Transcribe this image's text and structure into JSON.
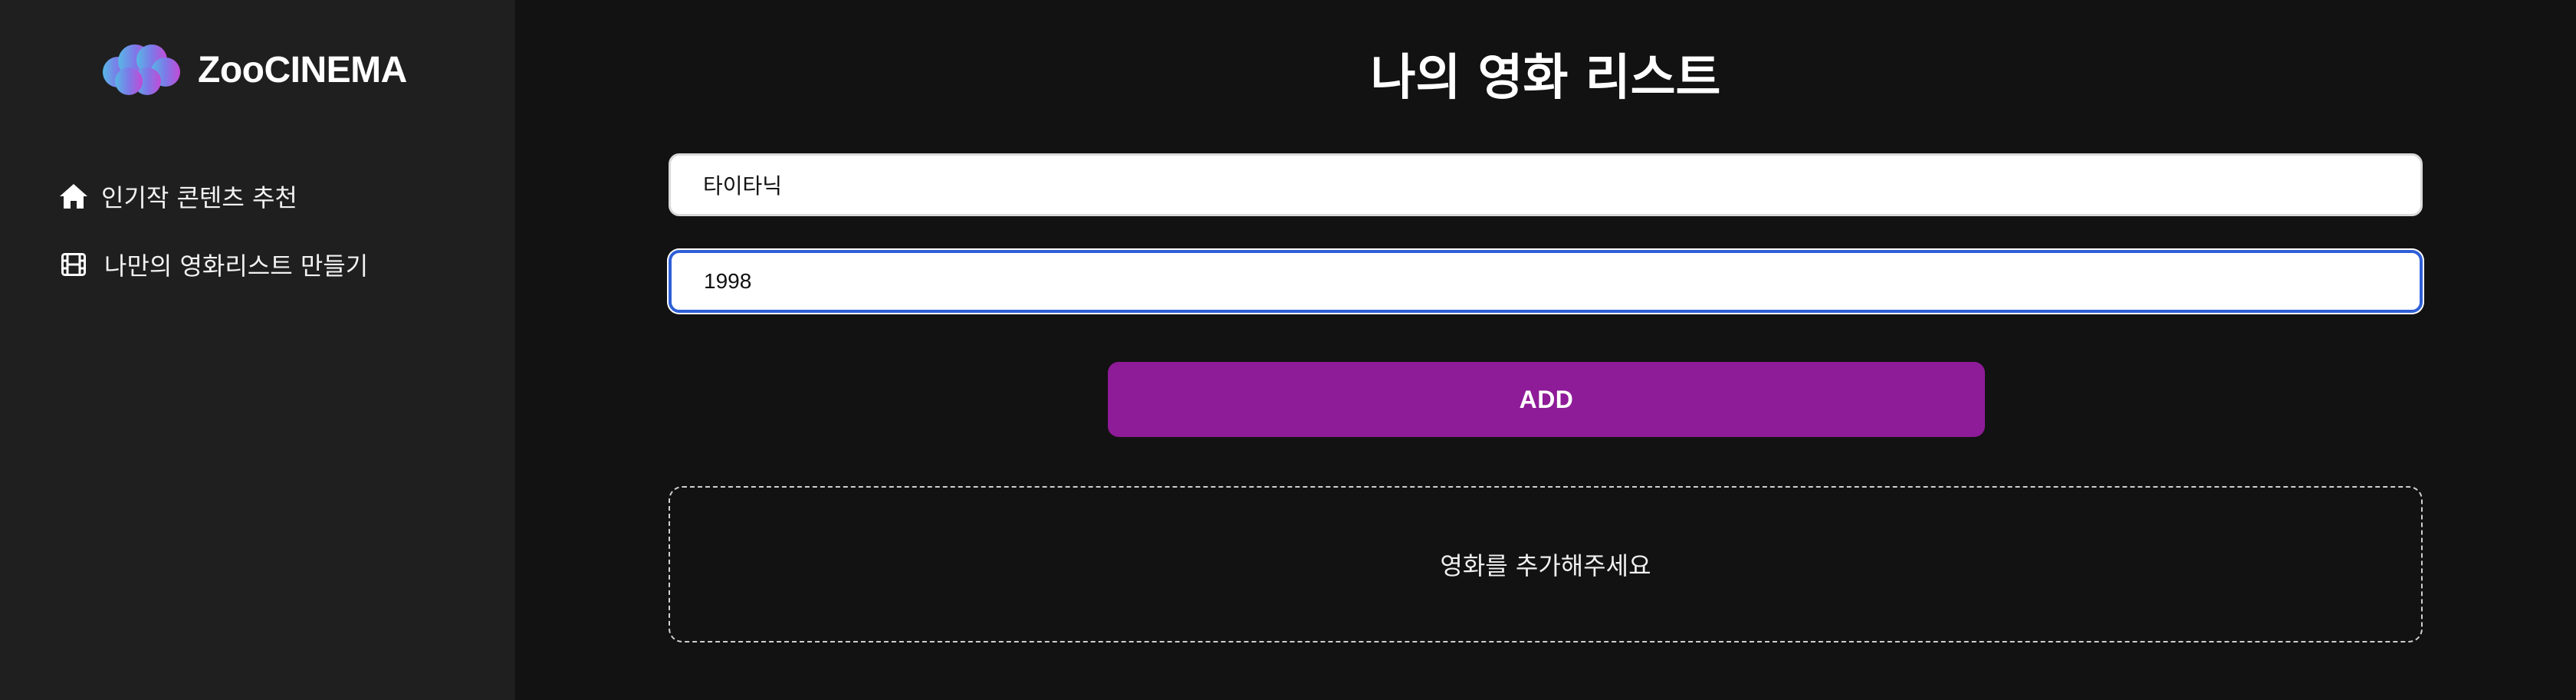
{
  "brand": {
    "name": "ZooCINEMA",
    "logo_colors": [
      "#58b7e6",
      "#7d79e8",
      "#c24bd6"
    ],
    "logo_icon": "cloud-logo-icon"
  },
  "sidebar": {
    "items": [
      {
        "icon": "home-icon",
        "label": "인기작 콘텐츠 추천"
      },
      {
        "icon": "film-icon",
        "label": "나만의 영화리스트 만들기"
      }
    ]
  },
  "main": {
    "title": "나의 영화 리스트",
    "title_input": {
      "value": "타이타닉"
    },
    "year_input": {
      "value": "1998"
    },
    "add_button_label": "ADD",
    "empty_message": "영화를 추가해주세요"
  },
  "colors": {
    "sidebar_bg": "#1f1f1f",
    "main_bg": "#121212",
    "accent": "#8e1b97",
    "focus_border": "#2f5fd6"
  }
}
